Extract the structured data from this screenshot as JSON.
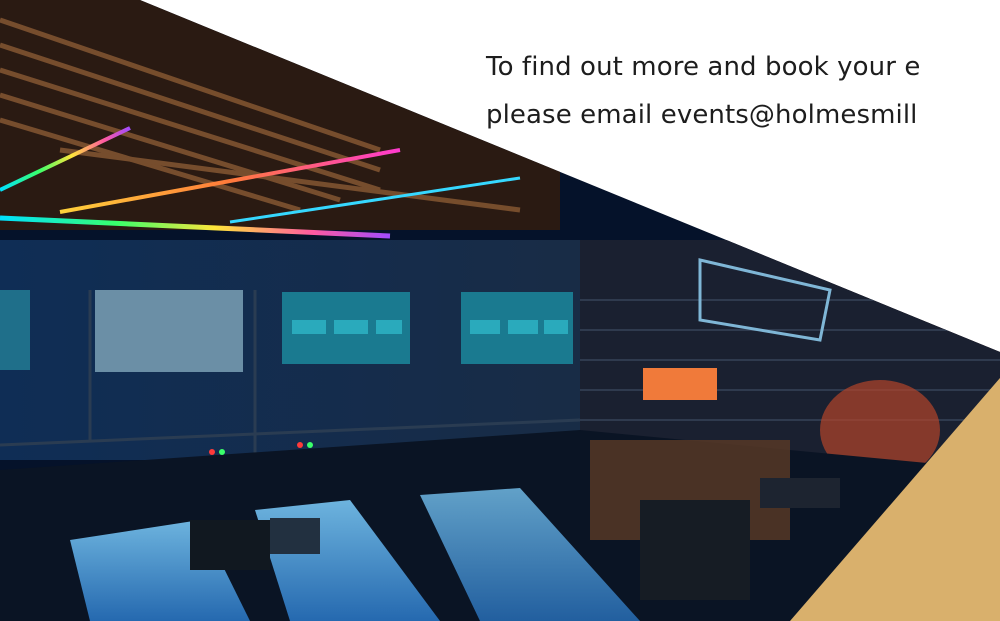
{
  "cta": {
    "line1": "To find out more and book your e",
    "line2": "please email events@holmesmill"
  },
  "colors": {
    "background": "#ffffff",
    "text": "#1d1d1d",
    "accent_gold": "#d9b06c"
  }
}
